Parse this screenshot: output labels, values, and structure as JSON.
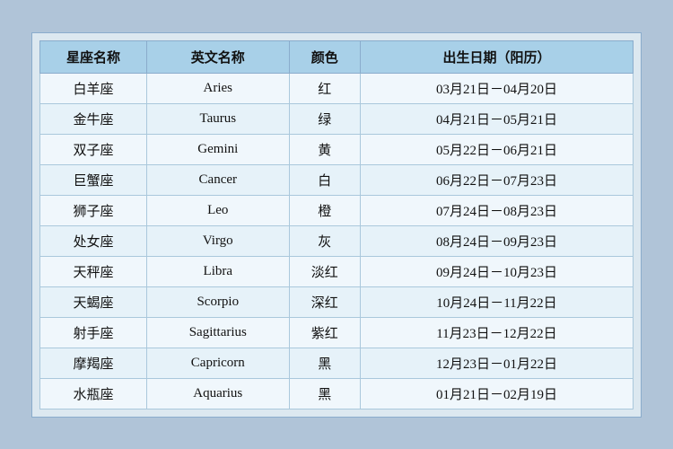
{
  "table": {
    "headers": {
      "chinese_name": "星座名称",
      "english_name": "英文名称",
      "color": "颜色",
      "birth_date": "出生日期（阳历）"
    },
    "rows": [
      {
        "chinese": "白羊座",
        "english": "Aries",
        "color": "红",
        "date": "03月21日－04月20日"
      },
      {
        "chinese": "金牛座",
        "english": "Taurus",
        "color": "绿",
        "date": "04月21日－05月21日"
      },
      {
        "chinese": "双子座",
        "english": "Gemini",
        "color": "黄",
        "date": "05月22日－06月21日"
      },
      {
        "chinese": "巨蟹座",
        "english": "Cancer",
        "color": "白",
        "date": "06月22日－07月23日"
      },
      {
        "chinese": "狮子座",
        "english": "Leo",
        "color": "橙",
        "date": "07月24日－08月23日"
      },
      {
        "chinese": "处女座",
        "english": "Virgo",
        "color": "灰",
        "date": "08月24日－09月23日"
      },
      {
        "chinese": "天秤座",
        "english": "Libra",
        "color": "淡红",
        "date": "09月24日－10月23日"
      },
      {
        "chinese": "天蝎座",
        "english": "Scorpio",
        "color": "深红",
        "date": "10月24日－11月22日"
      },
      {
        "chinese": "射手座",
        "english": "Sagittarius",
        "color": "紫红",
        "date": "11月23日－12月22日"
      },
      {
        "chinese": "摩羯座",
        "english": "Capricorn",
        "color": "黑",
        "date": "12月23日－01月22日"
      },
      {
        "chinese": "水瓶座",
        "english": "Aquarius",
        "color": "黑",
        "date": "01月21日－02月19日"
      }
    ]
  }
}
